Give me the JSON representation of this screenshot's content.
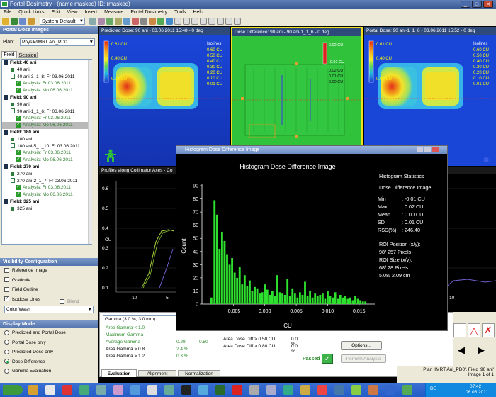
{
  "window": {
    "title": "Portal Dosimetry - (name masked)  ID: (masked)",
    "controls": [
      "_",
      "□",
      "✕"
    ]
  },
  "menu": [
    "File",
    "Quick Links",
    "Edit",
    "View",
    "Insert",
    "Measure",
    "Portal Dosimetry",
    "Tools",
    "Help"
  ],
  "toolbar": {
    "layout_select": "System Default"
  },
  "left_panel": {
    "header": "Portal Dose Images",
    "plan_label": "Plan:",
    "plan_value": "Physik/IMRT Ani_PD0",
    "tabs": [
      "Field",
      "Session"
    ],
    "tree": [
      {
        "label": "Field: 40 ani",
        "kind": "field"
      },
      {
        "label": "40 ani",
        "kind": "img"
      },
      {
        "label": "40 ani-3_1_8: Fr 03.06.2011",
        "kind": "img2"
      },
      {
        "label": "Analysis: Fr 03.06.2011",
        "kind": "analysis"
      },
      {
        "label": "Analysis: Mo 06.06.2011",
        "kind": "analysis"
      },
      {
        "label": "Field: 90 ani",
        "kind": "field"
      },
      {
        "label": "90 ani",
        "kind": "img"
      },
      {
        "label": "90 ani-1_1_6: Fr 03.06.2011",
        "kind": "img2"
      },
      {
        "label": "Analysis: Fr 03.06.2011",
        "kind": "analysis"
      },
      {
        "label": "Analysis: Mo 06.06.2011",
        "kind": "analysis",
        "selected": true
      },
      {
        "label": "Field: 180 ani",
        "kind": "field"
      },
      {
        "label": "180 ani",
        "kind": "img"
      },
      {
        "label": "180 ani-5_1_10: Fr 03.06.2011",
        "kind": "img2"
      },
      {
        "label": "Analysis: Fr 03.06.2011",
        "kind": "analysis"
      },
      {
        "label": "Analysis: Mo 06.06.2011",
        "kind": "analysis"
      },
      {
        "label": "Field: 270 ani",
        "kind": "field"
      },
      {
        "label": "270 ani",
        "kind": "img"
      },
      {
        "label": "270 ani-2_1_7: Fr 03.06.2011",
        "kind": "img2"
      },
      {
        "label": "Analysis: Fr 03.06.2011",
        "kind": "analysis"
      },
      {
        "label": "Analysis: Mo 06.06.2011",
        "kind": "analysis"
      },
      {
        "label": "Field: 325 ani",
        "kind": "field"
      },
      {
        "label": "325 ani",
        "kind": "img"
      }
    ],
    "visibility_header": "Visibility Configuration",
    "visibility": [
      {
        "label": "Reference Image",
        "checked": false
      },
      {
        "label": "Graticule",
        "checked": false
      },
      {
        "label": "Field Outline",
        "checked": false
      },
      {
        "label": "Isodose Lines",
        "checked": true
      }
    ],
    "blend_label": "Blend",
    "color_mode": "Color Wash",
    "display_header": "Display Mode",
    "display_modes": [
      {
        "label": "Predicted and Portal Dose",
        "selected": false
      },
      {
        "label": "Portal Dose only",
        "selected": false
      },
      {
        "label": "Predicted Dose only",
        "selected": false
      },
      {
        "label": "Dose Difference",
        "selected": true
      },
      {
        "label": "Gamma Evaluation",
        "selected": false
      }
    ]
  },
  "panels": {
    "predicted": {
      "title": "Predicted Dose: 90 ani - 03.06.2011 15:48 - 0 deg",
      "scale": [
        "0.61 CU",
        "0.40 CU",
        "0.00 CU"
      ],
      "isolines_title": "Isolines",
      "isolines": [
        "0.60 CU",
        "0.50 CU",
        "0.40 CU",
        "0.30 CU",
        "0.20 CU",
        "0.10 CU",
        "0.01 CU"
      ]
    },
    "difference": {
      "title": "Dose Difference: 90 ani - 90 ani-1_1_6 - 0 deg",
      "scale": [
        "0.02 CU",
        "-0.01 CU"
      ],
      "isolines": [
        "0.02 CU",
        "0.01 CU",
        "0.00 CU"
      ]
    },
    "portal": {
      "title": "Portal Dose: 90 ani-1_1_6 - 03.06.2011 15:52 - 0 deg",
      "scale": [
        "0.61 CU",
        "0.40 CU",
        "0.00 CU"
      ],
      "isolines_title": "Isolines",
      "isolines": [
        "0.60 CU",
        "0.50 CU",
        "0.40 CU",
        "0.30 CU",
        "0.20 CU",
        "0.10 CU",
        "0.01 CU"
      ]
    }
  },
  "profile": {
    "title": "Profiles along Collimator Axes - Co",
    "y_ticks": [
      "0.6",
      "0.5",
      "0.4",
      "0.3",
      "0.2",
      "0.1"
    ],
    "x_ticks": [
      "-10",
      "-5",
      "10"
    ],
    "ylabel": "CU"
  },
  "dialog": {
    "title": "Histogram Dose Difference Image"
  },
  "chart_data": {
    "type": "bar",
    "title": "Histogram Dose Difference Image",
    "xlabel": "CU",
    "ylabel": "Count",
    "xlim": [
      -0.01,
      0.0175
    ],
    "ylim": [
      0,
      90
    ],
    "x_ticks": [
      "-0.005",
      "0.000",
      "0.005",
      "0.010",
      "0.015"
    ],
    "y_ticks": [
      "0",
      "10",
      "20",
      "30",
      "40",
      "50",
      "60",
      "70",
      "80",
      "90"
    ],
    "x": [
      -0.0085,
      -0.008,
      -0.0076,
      -0.0072,
      -0.0068,
      -0.0064,
      -0.006,
      -0.0056,
      -0.0052,
      -0.0048,
      -0.0044,
      -0.004,
      -0.0036,
      -0.0032,
      -0.0028,
      -0.0024,
      -0.002,
      -0.0016,
      -0.0012,
      -0.0008,
      -0.0004,
      0.0,
      0.0004,
      0.0008,
      0.0012,
      0.0016,
      0.002,
      0.0024,
      0.0028,
      0.0032,
      0.0036,
      0.004,
      0.0044,
      0.0048,
      0.0052,
      0.0056,
      0.006,
      0.0064,
      0.0068,
      0.0072,
      0.0076,
      0.008,
      0.0084,
      0.0088,
      0.0092,
      0.0096,
      0.01,
      0.0104,
      0.0108,
      0.0112,
      0.0116,
      0.012,
      0.0124,
      0.0128,
      0.0132,
      0.0136,
      0.014,
      0.0144,
      0.0148,
      0.0152,
      0.0156,
      0.016
    ],
    "values": [
      5,
      79,
      68,
      42,
      55,
      48,
      38,
      30,
      35,
      24,
      20,
      28,
      15,
      22,
      14,
      18,
      10,
      13,
      12,
      8,
      9,
      15,
      11,
      7,
      10,
      6,
      22,
      9,
      8,
      7,
      19,
      6,
      12,
      8,
      5,
      9,
      7,
      17,
      6,
      10,
      5,
      8,
      6,
      7,
      8,
      4,
      10,
      6,
      5,
      9,
      4,
      7,
      5,
      6,
      4,
      5,
      3,
      6,
      4,
      3,
      2,
      2
    ],
    "stats": {
      "heading": "Histogram Statistics",
      "subheading": "Dose Difference Image:",
      "rows": [
        [
          "Min",
          ": -0.01 CU"
        ],
        [
          "Max",
          ": 0.02 CU"
        ],
        [
          "Mean",
          ": 0.00 CU"
        ],
        [
          "SD",
          ": 0.01 CU"
        ],
        [
          "RSD(%)",
          ": 246.40"
        ]
      ],
      "roi_position_label": "ROI Position (x/y):",
      "roi_position": "98/ 257 Pixels",
      "roi_size_label": "ROI Size (x/y):",
      "roi_size_px": "68/ 28 Pixels",
      "roi_size_cm": "5.08/ 2.09 cm"
    }
  },
  "evaluation": {
    "gamma_select": "Gamma (3.0 %, 3.0 mm)",
    "rows": [
      {
        "label": "Area Gamma < 1.0",
        "v1": "",
        "v2": ""
      },
      {
        "label": "Maximum Gamma",
        "v1": "",
        "v2": ""
      },
      {
        "label": "Average Gamma",
        "v1": "0.29",
        "v2": "0.50"
      },
      {
        "label": "Area Gamma > 0.8",
        "v1": "2.4 %",
        "v2": ""
      },
      {
        "label": "Area Gamma > 1.2",
        "v1": "0.3 %",
        "v2": ""
      }
    ],
    "diff_rows": [
      [
        "Area Dose Diff > 0.50 CU",
        "0.0 %"
      ],
      [
        "Area Dose Diff > 0.80 CU",
        "0.0 %"
      ]
    ],
    "passed": "Passed",
    "options_btn": "Options...",
    "perform_btn": "Perform Analysis",
    "tabs": [
      "Evaluation",
      "Alignment",
      "Normalization"
    ]
  },
  "status": {
    "plan": "Plan 'IMRT Ani_PD0', Field '90 ani'",
    "image": "Image 1 of 1"
  },
  "taskbar": {
    "time": "07:42",
    "date": "06.06.2011",
    "lang": "DE"
  }
}
